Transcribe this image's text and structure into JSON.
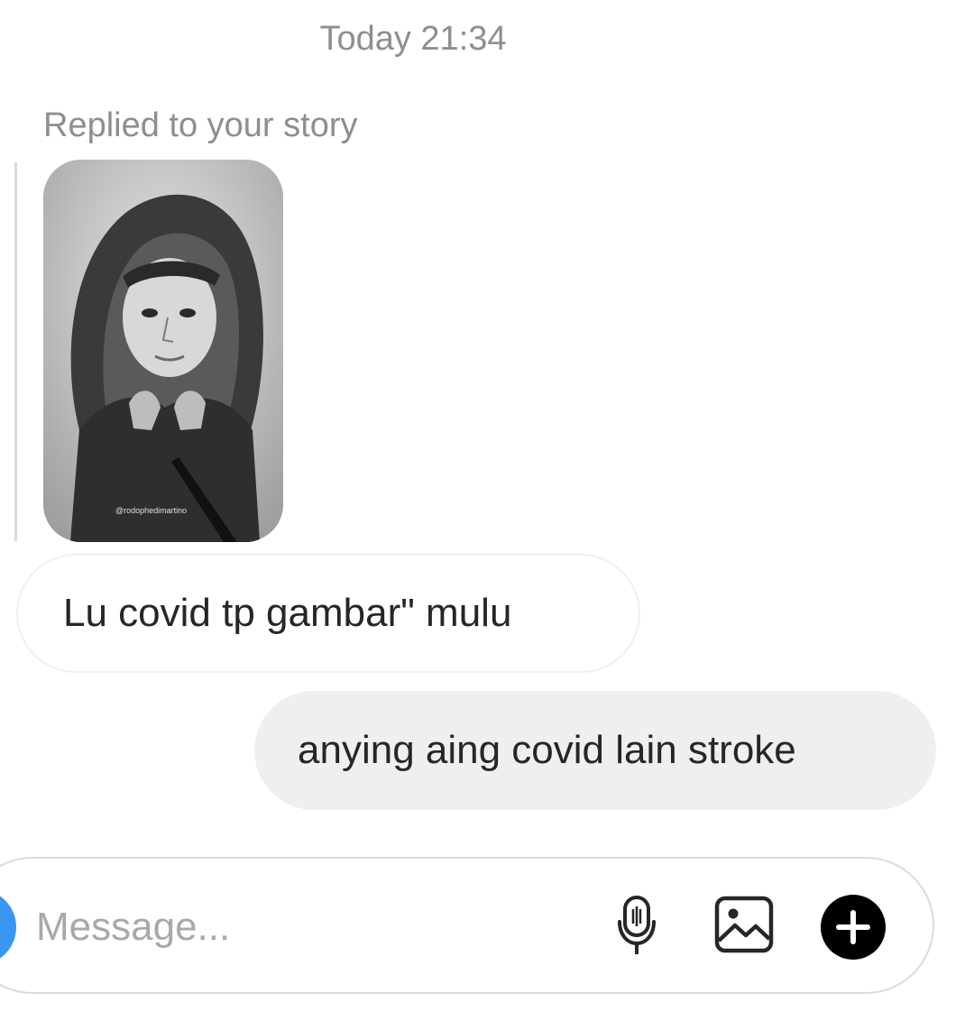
{
  "thread": {
    "timestamp": "Today 21:34",
    "reply_label": "Replied to your story",
    "story_thumbnail": {
      "icon": "story-drawing-thumbnail",
      "watermark": "@rodophedimartino"
    },
    "messages": [
      {
        "direction": "incoming",
        "text": "Lu covid tp gambar\" mulu"
      },
      {
        "direction": "outgoing",
        "text": "anying aing covid lain stroke"
      }
    ]
  },
  "composer": {
    "placeholder": "Message...",
    "value": "",
    "icons": {
      "camera": "camera-icon",
      "mic": "microphone-icon",
      "gallery": "gallery-icon",
      "more": "plus-icon"
    },
    "accent_color": "#3897f0"
  },
  "colors": {
    "secondary_text": "#8e8e8e",
    "outgoing_bubble": "#efefef",
    "border": "#dbdbdb"
  }
}
